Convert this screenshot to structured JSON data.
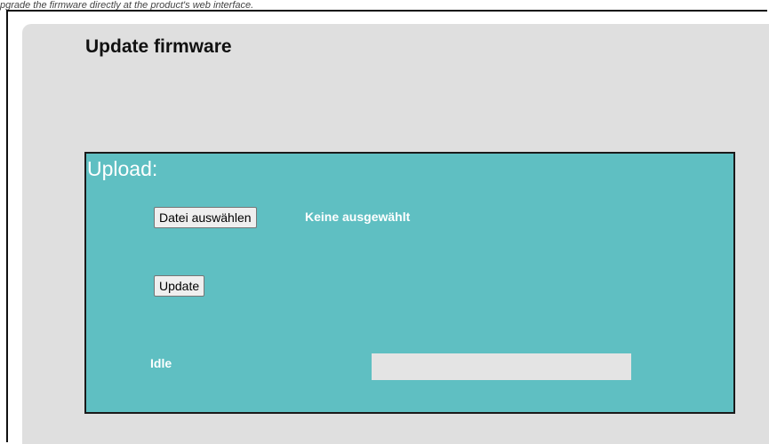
{
  "caption": "pgrade the firmware directly at the product's web interface.",
  "page": {
    "title": "Update firmware"
  },
  "upload": {
    "heading": "Upload:",
    "choose_file_label": "Datei auswählen",
    "file_status": "Keine ausgewählt",
    "update_label": "Update",
    "status_text": "Idle",
    "progress": 0
  },
  "colors": {
    "card_background": "#dfdfdf",
    "panel_background": "#5fbfc2",
    "panel_text": "#ffffff",
    "progress_track": "#e4e4e4"
  }
}
